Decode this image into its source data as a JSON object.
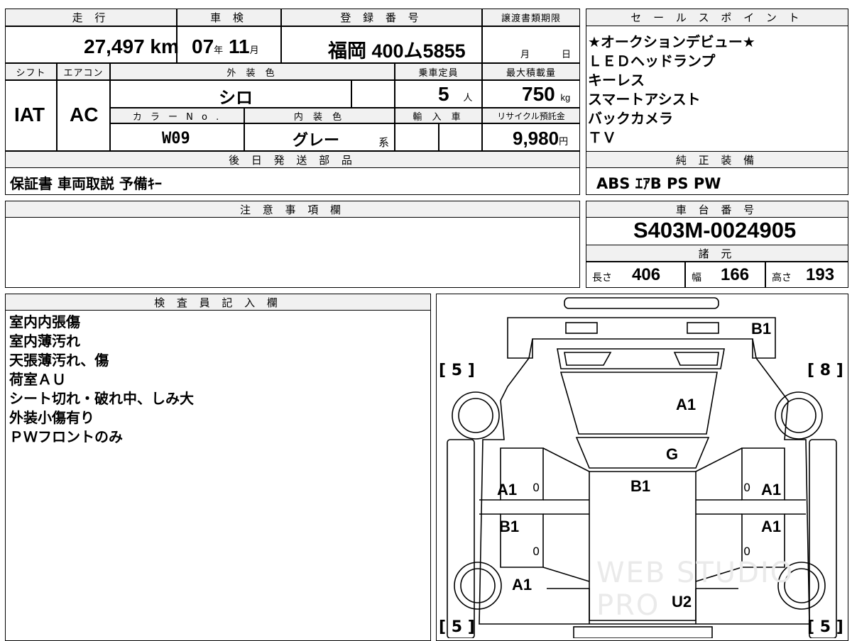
{
  "header": {
    "mileage_label": "走 行",
    "inspection_label": "車 検",
    "registration_label": "登 録 番 号",
    "transfer_label": "譲渡書類期限",
    "sales_point_label": "セ ー ル ス ポ イ ン ト"
  },
  "values": {
    "mileage": "27,497",
    "mileage_unit": "km",
    "inspection_year": "07",
    "year_unit": "年",
    "inspection_month": "11",
    "month_unit": "月",
    "registration": "福岡 400ム5855",
    "transfer_month_unit": "月",
    "transfer_day_unit": "日"
  },
  "row2": {
    "shift_label": "シフト",
    "ac_label": "エアコン",
    "exterior_label": "外 装 色",
    "capacity_label": "乗車定員",
    "maxload_label": "最大積載量",
    "shift": "IAT",
    "ac": "AC",
    "exterior": "シロ",
    "capacity": "5",
    "capacity_unit": "人",
    "maxload": "750",
    "maxload_unit": "kg",
    "color_no_label": "カ ラ ー N o .",
    "interior_label": "内 装 色",
    "import_label": "輸 入 車",
    "recycle_label": "リサイクル預託金",
    "color_no": "W09",
    "interior": "グレー",
    "interior_suffix": "系",
    "recycle": "9,980",
    "recycle_unit": "円"
  },
  "sales_points": [
    "★オークションデビュー★",
    "ＬＥＤヘッドランプ",
    "キーレス",
    "スマートアシスト",
    "バックカメラ",
    "ＴＶ"
  ],
  "later_parts": {
    "label": "後 日 発 送 部 品",
    "value": "保証書 車両取説 予備ｷｰ"
  },
  "equipment": {
    "label": "純 正 装 備",
    "value": "ABS ｴｱB PS PW"
  },
  "caution": {
    "label": "注 意 事 項 欄"
  },
  "chassis": {
    "label": "車 台 番 号",
    "value": "S403M-0024905"
  },
  "specs": {
    "label": "諸 元",
    "length_label": "長さ",
    "length": "406",
    "width_label": "幅",
    "width": "166",
    "height_label": "高さ",
    "height": "193"
  },
  "inspector": {
    "label": "検 査 員 記 入 欄",
    "notes": [
      "室内内張傷",
      "室内薄汚れ",
      "天張薄汚れ、傷",
      "荷室ＡＵ",
      "シート切れ・破れ中、しみ大",
      "外装小傷有り",
      "ＰＷフロントのみ"
    ]
  },
  "diagram": {
    "marks": {
      "b1_top": "B1",
      "a1_hood": "A1",
      "g_windshield": "G",
      "b1_roof": "B1",
      "a1_left_front_door": "A1",
      "b1_left_rear_door": "B1",
      "a1_right_front_door": "A1",
      "a1_right_rear_door": "A1",
      "a1_left_rear": "A1",
      "u2_rear": "U2",
      "zero_1": "0",
      "zero_2": "0",
      "zero_3": "0",
      "zero_4": "0"
    },
    "tires": {
      "front_left": "5",
      "front_right": "8",
      "rear_left": "5",
      "rear_right": "5"
    },
    "watermark": "WEB STUDIO PRO"
  }
}
